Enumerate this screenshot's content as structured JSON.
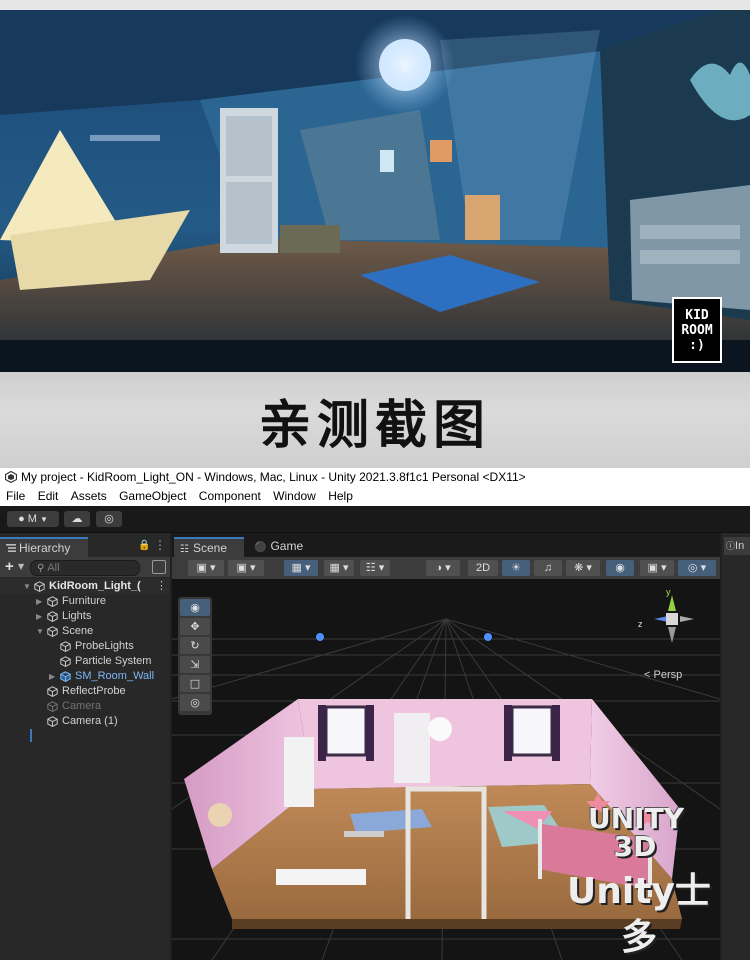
{
  "game_screenshot": {
    "logo_lines": [
      "KID",
      "ROOM",
      ":)"
    ]
  },
  "banner": {
    "text": "亲测截图"
  },
  "window": {
    "title": "My project - KidRoom_Light_ON - Windows, Mac, Linux - Unity 2021.3.8f1c1 Personal <DX11>"
  },
  "menu": [
    "File",
    "Edit",
    "Assets",
    "GameObject",
    "Component",
    "Window",
    "Help"
  ],
  "toolbar": {
    "account_label": "M"
  },
  "hierarchy": {
    "tab_label": "Hierarchy",
    "search_placeholder": "All",
    "items": [
      {
        "label": "KidRoom_Light_(",
        "depth": 0,
        "state": "root",
        "fold": "open"
      },
      {
        "label": "Furniture",
        "depth": 1,
        "state": "normal",
        "fold": "closed"
      },
      {
        "label": "Lights",
        "depth": 1,
        "state": "normal",
        "fold": "closed"
      },
      {
        "label": "Scene",
        "depth": 1,
        "state": "normal",
        "fold": "open"
      },
      {
        "label": "ProbeLights",
        "depth": 2,
        "state": "normal",
        "fold": "none"
      },
      {
        "label": "Particle System",
        "depth": 2,
        "state": "normal",
        "fold": "none"
      },
      {
        "label": "SM_Room_Wall",
        "depth": 2,
        "state": "prefab",
        "fold": "closed"
      },
      {
        "label": "ReflectProbe",
        "depth": 1,
        "state": "normal",
        "fold": "none"
      },
      {
        "label": "Camera",
        "depth": 1,
        "state": "disabled",
        "fold": "none"
      },
      {
        "label": "Camera (1)",
        "depth": 1,
        "state": "normal",
        "fold": "none"
      }
    ]
  },
  "scene": {
    "tabs": [
      "Scene",
      "Game"
    ],
    "toolbar_2d_label": "2D",
    "persp_label": "Persp",
    "gizmo_axes": {
      "y": "y",
      "z": "z"
    },
    "tools": [
      "view-tool",
      "move-tool",
      "rotate-tool",
      "scale-tool",
      "rect-tool",
      "transform-tool"
    ]
  },
  "inspector_tab": {
    "label": "In"
  },
  "watermark": {
    "lines": [
      "UNITY",
      "3D"
    ],
    "main": "Unity士多"
  },
  "colors": {
    "accent": "#3a79bb",
    "editor_bg": "#202020",
    "panel_bg": "#282828",
    "wall_pink": "#e8b8d6"
  }
}
